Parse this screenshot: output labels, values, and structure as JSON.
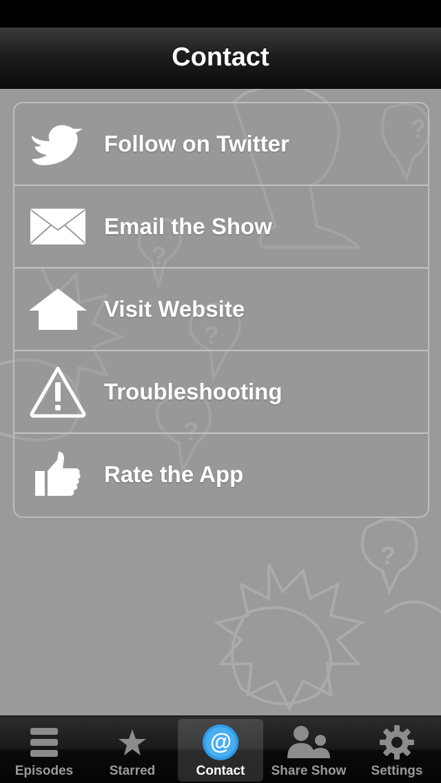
{
  "nav": {
    "title": "Contact"
  },
  "menu": {
    "items": [
      {
        "label": "Follow on Twitter",
        "icon": "twitter-bird-icon"
      },
      {
        "label": "Email the Show",
        "icon": "envelope-icon"
      },
      {
        "label": "Visit Website",
        "icon": "house-icon"
      },
      {
        "label": "Troubleshooting",
        "icon": "warning-icon"
      },
      {
        "label": "Rate the App",
        "icon": "thumbs-up-icon"
      }
    ]
  },
  "tabs": [
    {
      "label": "Episodes",
      "icon": "list-icon",
      "active": false
    },
    {
      "label": "Starred",
      "icon": "star-icon",
      "active": false
    },
    {
      "label": "Contact",
      "icon": "at-sign-icon",
      "active": true
    },
    {
      "label": "Share Show",
      "icon": "people-icon",
      "active": false
    },
    {
      "label": "Settings",
      "icon": "gear-icon",
      "active": false
    }
  ],
  "colors": {
    "background": "#9a9a9a",
    "nav_bar": "#1e1e1e",
    "active_tab_icon": "#2f9be8",
    "text": "#ffffff"
  }
}
